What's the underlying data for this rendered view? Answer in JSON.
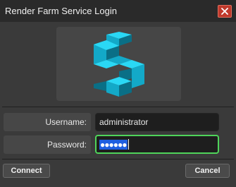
{
  "window": {
    "title": "Render Farm Service Login"
  },
  "logo": {
    "colors": {
      "light": "#2ad8f5",
      "mid": "#13a9c8",
      "dark": "#0a6f86"
    }
  },
  "form": {
    "username": {
      "label": "Username:",
      "value": "administrator"
    },
    "password": {
      "label": "Password:",
      "masked_value": "●●●●●●"
    }
  },
  "buttons": {
    "connect": "Connect",
    "cancel": "Cancel"
  },
  "colors": {
    "focus_border": "#4fd45a",
    "selection": "#1f5fe0",
    "close": "#c0392b"
  }
}
